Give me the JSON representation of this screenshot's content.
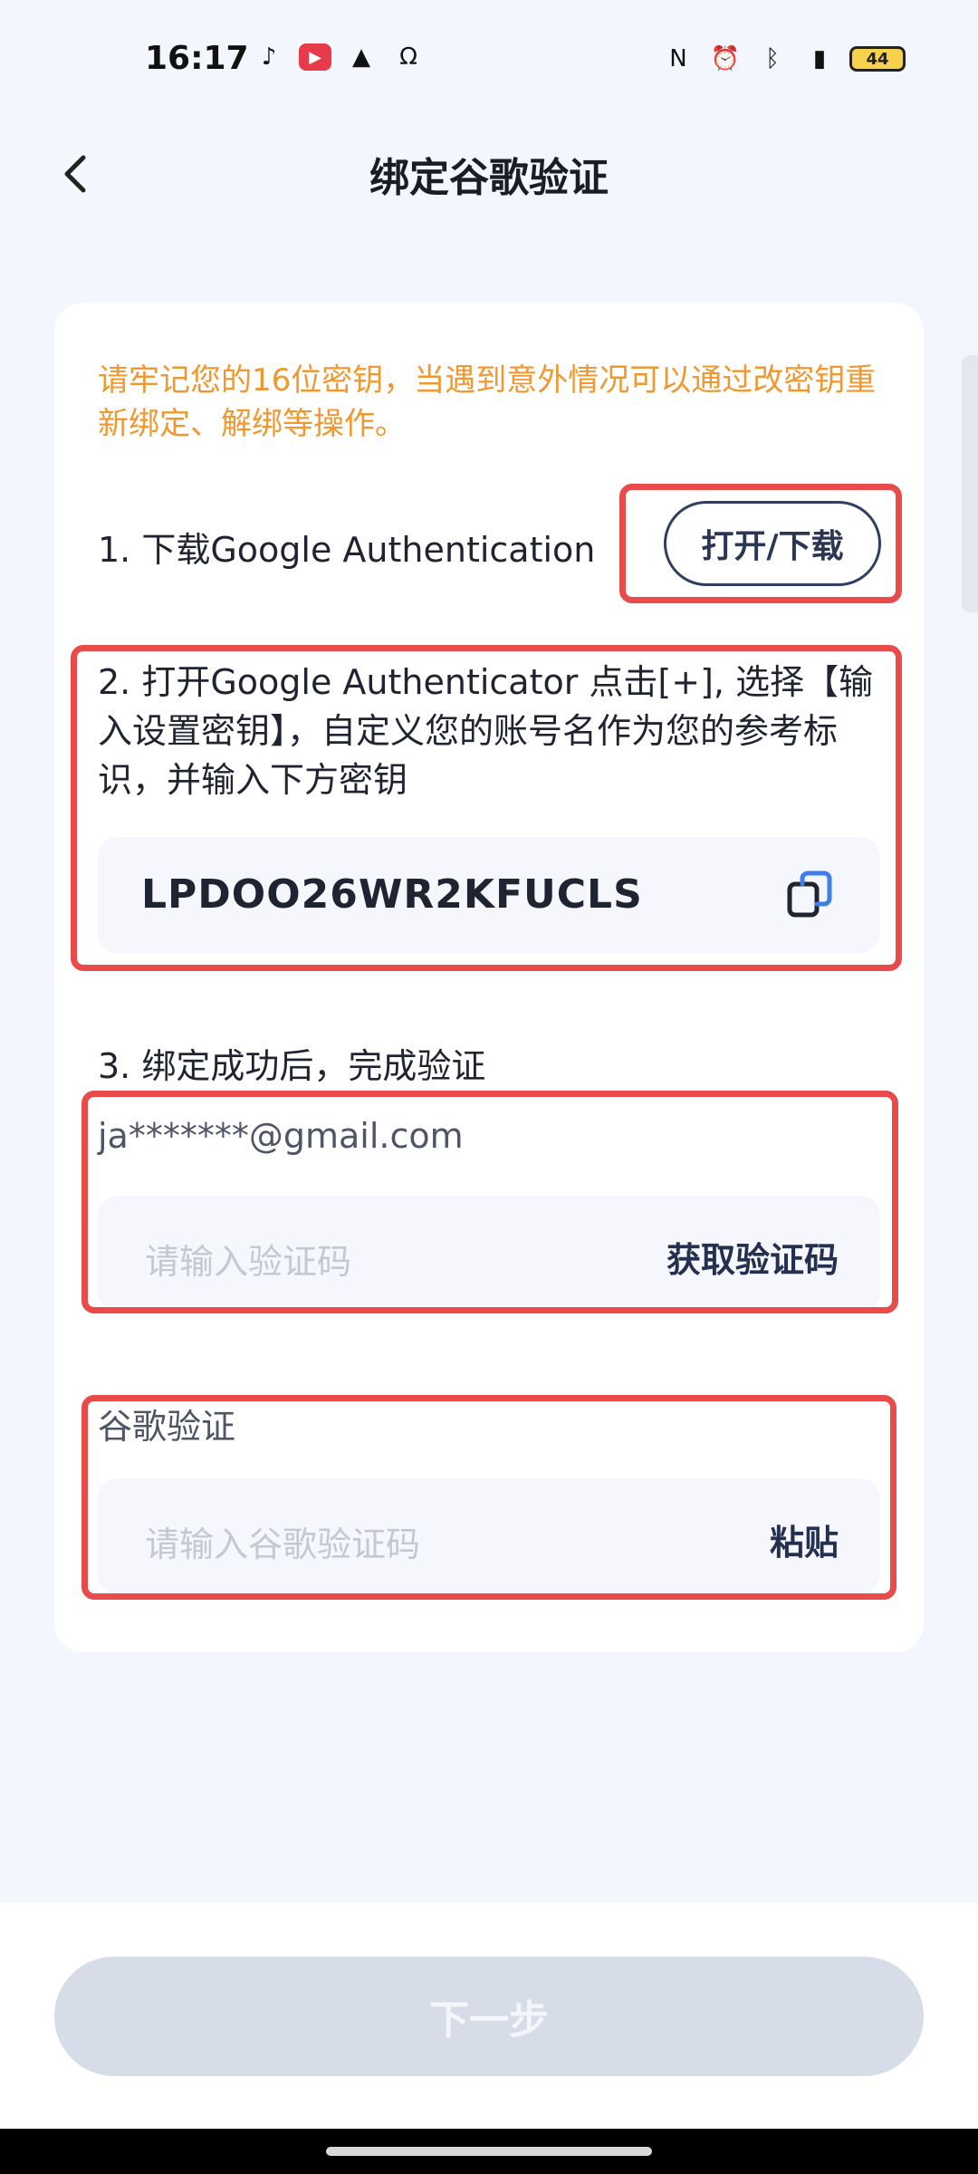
{
  "status_bar": {
    "time": "16:17",
    "left_icons": [
      "tiktok-like-icon",
      "video-app-icon",
      "adidas-icon",
      "search-app-icon"
    ],
    "right_icons": [
      "nfc-icon",
      "alarm-icon",
      "bluetooth-icon",
      "signal-icon"
    ],
    "battery": "44"
  },
  "header": {
    "title": "绑定谷歌验证"
  },
  "card": {
    "notice": "请牢记您的16位密钥，当遇到意外情况可以通过改密钥重新绑定、解绑等操作。",
    "step1": {
      "label": "1. 下载Google Authentication",
      "button": "打开/下载"
    },
    "step2": {
      "label": "2. 打开Google Authenticator 点击[+], 选择【输入设置密钥】，自定义您的账号名作为您的参考标识，并输入下方密钥",
      "secret_key": "LPDOO26WR2KFUCLS"
    },
    "step3": {
      "label": "3. 绑定成功后，完成验证",
      "email": "ja*******@gmail.com",
      "email_code_placeholder": "请输入验证码",
      "get_code": "获取验证码"
    },
    "google": {
      "label": "谷歌验证",
      "placeholder": "请输入谷歌验证码",
      "paste": "粘贴"
    }
  },
  "footer": {
    "next": "下一步"
  },
  "colors": {
    "notice": "#f0982f",
    "highlight": "#e94b4b",
    "button_disabled": "#d6dce8"
  }
}
